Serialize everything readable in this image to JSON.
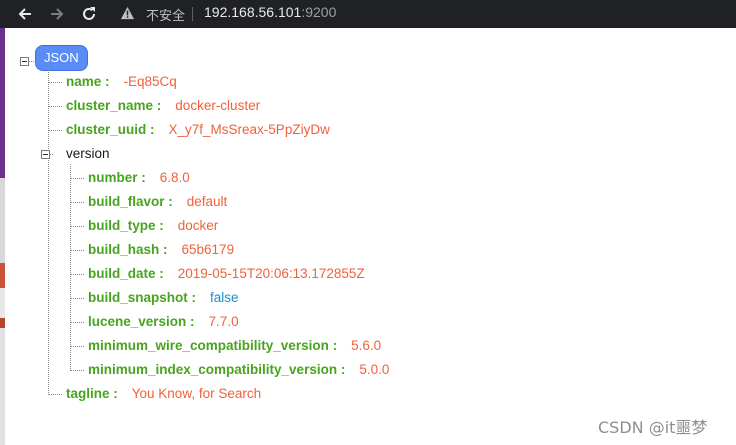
{
  "browser": {
    "security_label": "不安全",
    "url_host": "192.168.56.101",
    "url_port": ":9200"
  },
  "json_root": {
    "label": "JSON",
    "entries": [
      {
        "key": "name :",
        "value": "-Eq85Cq"
      },
      {
        "key": "cluster_name :",
        "value": "docker-cluster"
      },
      {
        "key": "cluster_uuid :",
        "value": "X_y7f_MsSreax-5PpZiyDw"
      }
    ],
    "version": {
      "label": "version",
      "entries": [
        {
          "key": "number :",
          "value": "6.8.0"
        },
        {
          "key": "build_flavor :",
          "value": "default"
        },
        {
          "key": "build_type :",
          "value": "docker"
        },
        {
          "key": "build_hash :",
          "value": "65b6179"
        },
        {
          "key": "build_date :",
          "value": "2019-05-15T20:06:13.172855Z"
        },
        {
          "key": "build_snapshot :",
          "value": "false"
        },
        {
          "key": "lucene_version :",
          "value": "7.7.0"
        },
        {
          "key": "minimum_wire_compatibility_version :",
          "value": "5.6.0"
        },
        {
          "key": "minimum_index_compatibility_version :",
          "value": "5.0.0"
        }
      ]
    },
    "tagline": {
      "key": "tagline :",
      "value": "You Know, for Search"
    }
  },
  "watermark": "CSDN @it噩梦",
  "colors": {
    "key": "#48a41e",
    "string_value": "#f0613a",
    "boolean_value": "#1a8fc8",
    "root_badge": "#5a8cf5"
  }
}
